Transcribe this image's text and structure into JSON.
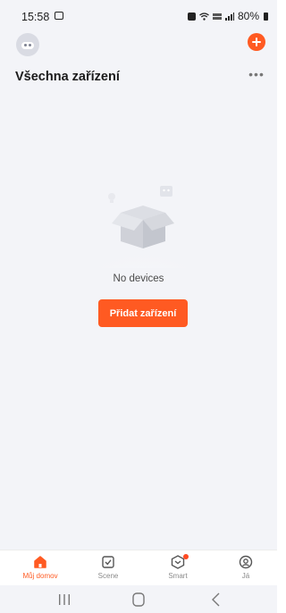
{
  "status_bar": {
    "time": "15:58",
    "battery": "80%",
    "icons": [
      "gallery-icon",
      "alarm-icon",
      "wifi-icon",
      "lte-icon",
      "signal-icon",
      "battery-icon"
    ]
  },
  "header": {
    "title": "Všechna zařízení",
    "more_label": "•••"
  },
  "empty_state": {
    "message": "No devices",
    "add_button_label": "Přidat zařízení"
  },
  "tabs": [
    {
      "label": "Můj domov",
      "icon": "home-icon",
      "active": true
    },
    {
      "label": "Scene",
      "icon": "scene-icon",
      "active": false
    },
    {
      "label": "Smart",
      "icon": "smart-icon",
      "active": false
    },
    {
      "label": "Já",
      "icon": "profile-icon",
      "active": false
    }
  ],
  "colors": {
    "accent": "#ff5a22",
    "background": "#f3f4f8",
    "inactive_tab": "#8a8a8a"
  }
}
